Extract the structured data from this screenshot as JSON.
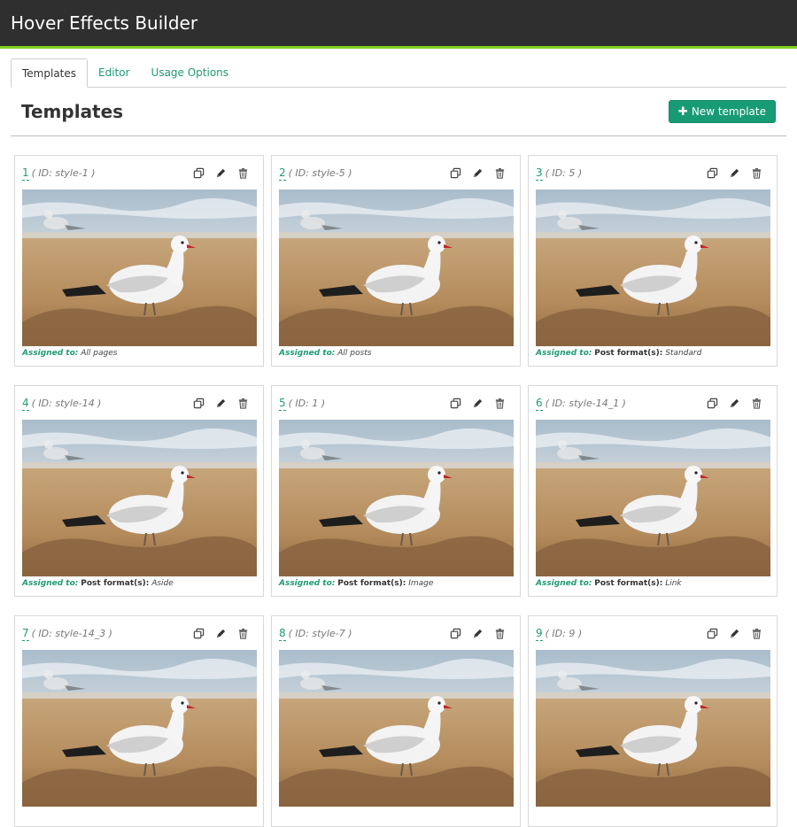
{
  "app": {
    "title": "Hover Effects Builder"
  },
  "tabs": [
    {
      "label": "Templates",
      "active": true
    },
    {
      "label": "Editor",
      "active": false
    },
    {
      "label": "Usage Options",
      "active": false
    }
  ],
  "page": {
    "title": "Templates",
    "new_button": "New template"
  },
  "assigned_label": "Assigned to:",
  "templates": [
    {
      "num": "1",
      "id_text": "( ID: style-1 )",
      "format_label": "",
      "value": "All pages"
    },
    {
      "num": "2",
      "id_text": "( ID: style-5 )",
      "format_label": "",
      "value": "All posts"
    },
    {
      "num": "3",
      "id_text": "( ID: 5 )",
      "format_label": "Post format(s):",
      "value": "Standard"
    },
    {
      "num": "4",
      "id_text": "( ID: style-14 )",
      "format_label": "Post format(s):",
      "value": "Aside"
    },
    {
      "num": "5",
      "id_text": "( ID: 1 )",
      "format_label": "Post format(s):",
      "value": "Image"
    },
    {
      "num": "6",
      "id_text": "( ID: style-14_1 )",
      "format_label": "Post format(s):",
      "value": "Link"
    },
    {
      "num": "7",
      "id_text": "( ID: style-14_3 )",
      "format_label": "",
      "value": ""
    },
    {
      "num": "8",
      "id_text": "( ID: style-7 )",
      "format_label": "",
      "value": ""
    },
    {
      "num": "9",
      "id_text": "( ID: 9 )",
      "format_label": "",
      "value": ""
    }
  ],
  "icons": {
    "copy": "copy-icon",
    "edit": "pencil-icon",
    "delete": "trash-icon",
    "add": "plus-icon"
  },
  "colors": {
    "accent": "#179b74",
    "topbar": "#2f2f2f",
    "topbar_border": "#7ed321"
  }
}
